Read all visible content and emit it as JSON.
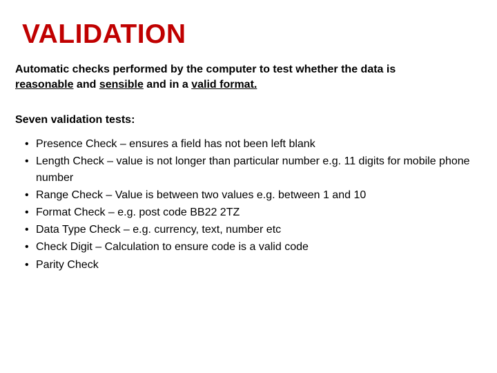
{
  "title": "VALIDATION",
  "intro_parts": {
    "p1": "Automatic checks performed by the computer to test whether the data is ",
    "u1": "reasonable",
    "p2": " and ",
    "u2": "sensible",
    "p3": " and in a ",
    "u3": "valid format.",
    "p4": ""
  },
  "subhead": "Seven validation tests:",
  "items": [
    "Presence Check – ensures a field has not been left blank",
    "Length Check – value is not longer than particular number e.g. 11 digits for mobile phone number",
    "Range Check – Value is between two values e.g. between 1 and 10",
    "Format Check – e.g. post code BB22 2TZ",
    "Data Type Check – e.g. currency, text, number etc",
    "Check Digit – Calculation to ensure code is a valid code",
    "Parity Check"
  ]
}
